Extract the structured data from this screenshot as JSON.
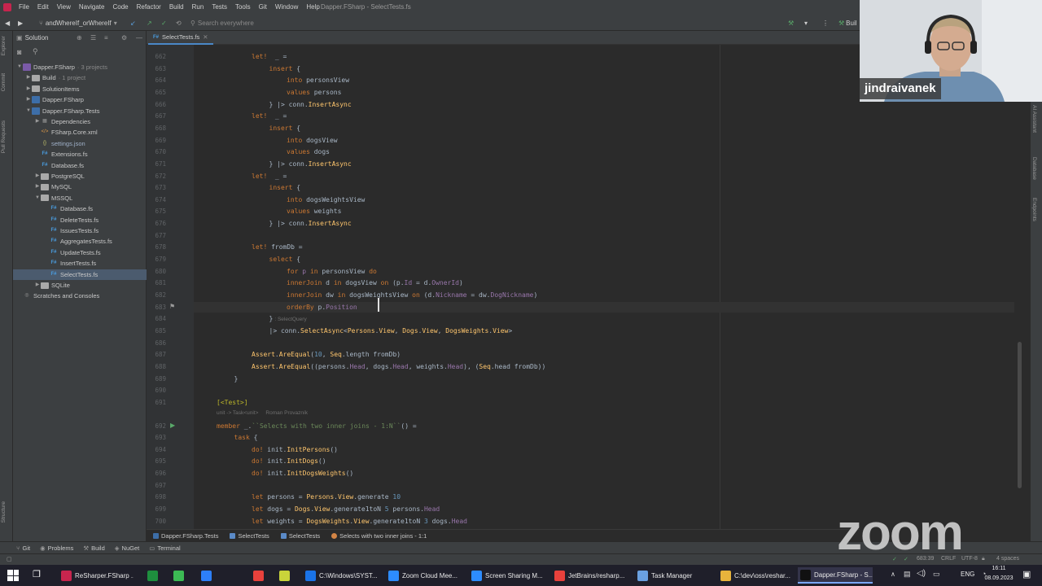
{
  "window": {
    "title": "Dapper.FSharp - SelectTests.fs"
  },
  "menu": [
    "File",
    "Edit",
    "View",
    "Navigate",
    "Code",
    "Refactor",
    "Build",
    "Run",
    "Tests",
    "Tools",
    "Git",
    "Window",
    "Help"
  ],
  "toolbar": {
    "branch": "andWhereIf_orWhereIf",
    "search_placeholder": "Search everywhere",
    "build_label": "Buil"
  },
  "left_strip": [
    "Explorer",
    "Commit",
    "Pull Requests",
    "Structure"
  ],
  "project": {
    "header": "Solution",
    "tree": [
      {
        "label": "Dapper.FSharp",
        "note": "· 3 projects",
        "icon": "solution-icon",
        "depth": 0,
        "expanded": true
      },
      {
        "label": "Build",
        "note": "· 1 project",
        "icon": "folder-icon",
        "depth": 1,
        "expanded": false
      },
      {
        "label": "SolutionItems",
        "note": "",
        "icon": "folder-icon",
        "depth": 1,
        "expanded": false
      },
      {
        "label": "Dapper.FSharp",
        "note": "",
        "icon": "project-icon",
        "depth": 1,
        "expanded": false
      },
      {
        "label": "Dapper.FSharp.Tests",
        "note": "",
        "icon": "project-icon",
        "depth": 1,
        "expanded": true
      },
      {
        "label": "Dependencies",
        "note": "",
        "icon": "dependencies-icon",
        "depth": 2,
        "expanded": false
      },
      {
        "label": "FSharp.Core.xml",
        "note": "",
        "icon": "xml-file-icon",
        "depth": 2
      },
      {
        "label": "settings.json",
        "note": "",
        "icon": "json-file-icon",
        "depth": 2
      },
      {
        "label": "Extensions.fs",
        "note": "",
        "icon": "fs-file-icon",
        "depth": 2
      },
      {
        "label": "Database.fs",
        "note": "",
        "icon": "fs-file-icon",
        "depth": 2
      },
      {
        "label": "PostgreSQL",
        "note": "",
        "icon": "folder-icon",
        "depth": 2,
        "expanded": false
      },
      {
        "label": "MySQL",
        "note": "",
        "icon": "folder-icon",
        "depth": 2,
        "expanded": false
      },
      {
        "label": "MSSQL",
        "note": "",
        "icon": "folder-icon",
        "depth": 2,
        "expanded": true
      },
      {
        "label": "Database.fs",
        "note": "",
        "icon": "fs-file-icon",
        "depth": 3
      },
      {
        "label": "DeleteTests.fs",
        "note": "",
        "icon": "fs-file-icon",
        "depth": 3
      },
      {
        "label": "IssuesTests.fs",
        "note": "",
        "icon": "fs-file-icon",
        "depth": 3
      },
      {
        "label": "AggregatesTests.fs",
        "note": "",
        "icon": "fs-file-icon",
        "depth": 3
      },
      {
        "label": "UpdateTests.fs",
        "note": "",
        "icon": "fs-file-icon",
        "depth": 3
      },
      {
        "label": "InsertTests.fs",
        "note": "",
        "icon": "fs-file-icon",
        "depth": 3
      },
      {
        "label": "SelectTests.fs",
        "note": "",
        "icon": "fs-file-icon",
        "depth": 3,
        "selected": true
      },
      {
        "label": "SQLite",
        "note": "",
        "icon": "folder-icon",
        "depth": 2,
        "expanded": false
      },
      {
        "label": "Scratches and Consoles",
        "note": "",
        "icon": "scratches-icon",
        "depth": 0
      }
    ]
  },
  "editor": {
    "tab": "SelectTests.fs",
    "lines": [
      {
        "n": "662",
        "indent": 2,
        "t": [
          [
            "kw",
            "let!"
          ],
          [
            "",
            "  _ ="
          ]
        ]
      },
      {
        "n": "663",
        "indent": 3,
        "t": [
          [
            "kw",
            "insert"
          ],
          [
            "",
            " {"
          ]
        ]
      },
      {
        "n": "664",
        "indent": 4,
        "t": [
          [
            "kw",
            "into"
          ],
          [
            "",
            " personsView"
          ]
        ]
      },
      {
        "n": "665",
        "indent": 4,
        "t": [
          [
            "kw",
            "values"
          ],
          [
            "",
            " persons"
          ]
        ]
      },
      {
        "n": "666",
        "indent": 3,
        "t": [
          [
            "",
            "} |> conn."
          ],
          [
            "fn",
            "InsertAsync"
          ]
        ]
      },
      {
        "n": "667",
        "indent": 2,
        "t": [
          [
            "kw",
            "let!"
          ],
          [
            "",
            "  _ ="
          ]
        ]
      },
      {
        "n": "668",
        "indent": 3,
        "t": [
          [
            "kw",
            "insert"
          ],
          [
            "",
            " {"
          ]
        ]
      },
      {
        "n": "669",
        "indent": 4,
        "t": [
          [
            "kw",
            "into"
          ],
          [
            "",
            " dogsView"
          ]
        ]
      },
      {
        "n": "670",
        "indent": 4,
        "t": [
          [
            "kw",
            "values"
          ],
          [
            "",
            " dogs"
          ]
        ]
      },
      {
        "n": "671",
        "indent": 3,
        "t": [
          [
            "",
            "} |> conn."
          ],
          [
            "fn",
            "InsertAsync"
          ]
        ]
      },
      {
        "n": "672",
        "indent": 2,
        "t": [
          [
            "kw",
            "let!"
          ],
          [
            "",
            "  _ ="
          ]
        ]
      },
      {
        "n": "673",
        "indent": 3,
        "t": [
          [
            "kw",
            "insert"
          ],
          [
            "",
            " {"
          ]
        ]
      },
      {
        "n": "674",
        "indent": 4,
        "t": [
          [
            "kw",
            "into"
          ],
          [
            "",
            " dogsWeightsView"
          ]
        ]
      },
      {
        "n": "675",
        "indent": 4,
        "t": [
          [
            "kw",
            "values"
          ],
          [
            "",
            " weights"
          ]
        ]
      },
      {
        "n": "676",
        "indent": 3,
        "t": [
          [
            "",
            "} |> conn."
          ],
          [
            "fn",
            "InsertAsync"
          ]
        ]
      },
      {
        "n": "677",
        "indent": 0,
        "t": []
      },
      {
        "n": "678",
        "indent": 2,
        "t": [
          [
            "kw",
            "let!"
          ],
          [
            "",
            " fromDb ="
          ]
        ]
      },
      {
        "n": "679",
        "indent": 3,
        "t": [
          [
            "kw",
            "select"
          ],
          [
            "",
            " {"
          ]
        ]
      },
      {
        "n": "680",
        "indent": 4,
        "t": [
          [
            "kw",
            "for"
          ],
          [
            "",
            " "
          ],
          [
            "vl",
            "p"
          ],
          [
            "",
            " "
          ],
          [
            "kw",
            "in"
          ],
          [
            "",
            " personsView "
          ],
          [
            "kw",
            "do"
          ]
        ]
      },
      {
        "n": "681",
        "indent": 4,
        "t": [
          [
            "kw",
            "innerJoin"
          ],
          [
            "",
            " d "
          ],
          [
            "kw",
            "in"
          ],
          [
            "",
            " dogsView "
          ],
          [
            "kw",
            "on"
          ],
          [
            "",
            " (p."
          ],
          [
            "vl",
            "Id"
          ],
          [
            "",
            " = d."
          ],
          [
            "vl",
            "OwnerId"
          ],
          [
            "",
            ")"
          ]
        ]
      },
      {
        "n": "682",
        "indent": 4,
        "t": [
          [
            "kw",
            "innerJoin"
          ],
          [
            "",
            " dw "
          ],
          [
            "kw",
            "in"
          ],
          [
            "",
            " dogsWeightsView "
          ],
          [
            "kw",
            "on"
          ],
          [
            "",
            " (d."
          ],
          [
            "vl",
            "Nickname"
          ],
          [
            "",
            " = dw."
          ],
          [
            "vl",
            "DogNickname"
          ],
          [
            "",
            ")"
          ]
        ]
      },
      {
        "n": "683",
        "indent": 4,
        "t": [
          [
            "kw",
            "orderBy"
          ],
          [
            "",
            " p."
          ],
          [
            "vl",
            "Position"
          ]
        ],
        "current": true
      },
      {
        "n": "684",
        "indent": 3,
        "t": [
          [
            "",
            "}"
          ]
        ],
        "hint": ": SelectQuery"
      },
      {
        "n": "685",
        "indent": 3,
        "t": [
          [
            "",
            "|> conn."
          ],
          [
            "fn",
            "SelectAsync"
          ],
          [
            "",
            "<"
          ],
          [
            "ty",
            "Persons"
          ],
          [
            "",
            "."
          ],
          [
            "ty",
            "View"
          ],
          [
            "",
            ", "
          ],
          [
            "ty",
            "Dogs"
          ],
          [
            "",
            "."
          ],
          [
            "ty",
            "View"
          ],
          [
            "",
            ", "
          ],
          [
            "ty",
            "DogsWeights"
          ],
          [
            "",
            "."
          ],
          [
            "ty",
            "View"
          ],
          [
            "",
            ">"
          ]
        ]
      },
      {
        "n": "686",
        "indent": 0,
        "t": []
      },
      {
        "n": "687",
        "indent": 2,
        "t": [
          [
            "ty",
            "Assert"
          ],
          [
            "",
            "."
          ],
          [
            "fn",
            "AreEqual"
          ],
          [
            "",
            "("
          ],
          [
            "nm",
            "10"
          ],
          [
            "",
            ", "
          ],
          [
            "ty",
            "Seq"
          ],
          [
            "",
            ".length fromDb)"
          ]
        ]
      },
      {
        "n": "688",
        "indent": 2,
        "t": [
          [
            "ty",
            "Assert"
          ],
          [
            "",
            "."
          ],
          [
            "fn",
            "AreEqual"
          ],
          [
            "",
            "((persons."
          ],
          [
            "vl",
            "Head"
          ],
          [
            "",
            ", dogs."
          ],
          [
            "vl",
            "Head"
          ],
          [
            "",
            ", weights."
          ],
          [
            "vl",
            "Head"
          ],
          [
            "",
            "), ("
          ],
          [
            "ty",
            "Seq"
          ],
          [
            "",
            ".head fromDb))"
          ]
        ]
      },
      {
        "n": "689",
        "indent": 1,
        "t": [
          [
            "",
            "}"
          ]
        ]
      },
      {
        "n": "690",
        "indent": 0,
        "t": []
      },
      {
        "n": "691",
        "indent": 0,
        "t": [
          [
            "at",
            "[<Test>]"
          ]
        ],
        "hint_below": "unit -> Task<unit>     Roman Provazník"
      },
      {
        "n": "692",
        "indent": 0,
        "t": [
          [
            "kw",
            "member"
          ],
          [
            "",
            " _."
          ],
          [
            "st",
            "``Selects with two inner joins - 1:N``"
          ],
          [
            "",
            "() ="
          ]
        ],
        "runnable": true
      },
      {
        "n": "693",
        "indent": 1,
        "t": [
          [
            "kw",
            "task"
          ],
          [
            "",
            " {"
          ]
        ]
      },
      {
        "n": "694",
        "indent": 2,
        "t": [
          [
            "kw",
            "do!"
          ],
          [
            "",
            " init."
          ],
          [
            "fn",
            "InitPersons"
          ],
          [
            "",
            "()"
          ]
        ]
      },
      {
        "n": "695",
        "indent": 2,
        "t": [
          [
            "kw",
            "do!"
          ],
          [
            "",
            " init."
          ],
          [
            "fn",
            "InitDogs"
          ],
          [
            "",
            "()"
          ]
        ]
      },
      {
        "n": "696",
        "indent": 2,
        "t": [
          [
            "kw",
            "do!"
          ],
          [
            "",
            " init."
          ],
          [
            "fn",
            "InitDogsWeights"
          ],
          [
            "",
            "()"
          ]
        ]
      },
      {
        "n": "697",
        "indent": 0,
        "t": []
      },
      {
        "n": "698",
        "indent": 2,
        "t": [
          [
            "kw",
            "let"
          ],
          [
            "",
            " persons = "
          ],
          [
            "ty",
            "Persons"
          ],
          [
            "",
            "."
          ],
          [
            "ty",
            "View"
          ],
          [
            "",
            ".generate "
          ],
          [
            "nm",
            "10"
          ]
        ]
      },
      {
        "n": "699",
        "indent": 2,
        "t": [
          [
            "kw",
            "let"
          ],
          [
            "",
            " dogs = "
          ],
          [
            "ty",
            "Dogs"
          ],
          [
            "",
            "."
          ],
          [
            "ty",
            "View"
          ],
          [
            "",
            ".generate1toN "
          ],
          [
            "nm",
            "5"
          ],
          [
            "",
            " persons."
          ],
          [
            "vl",
            "Head"
          ]
        ]
      },
      {
        "n": "700",
        "indent": 2,
        "t": [
          [
            "kw",
            "let"
          ],
          [
            "",
            " weights = "
          ],
          [
            "ty",
            "DogsWeights"
          ],
          [
            "",
            "."
          ],
          [
            "ty",
            "View"
          ],
          [
            "",
            ".generate1toN "
          ],
          [
            "nm",
            "3"
          ],
          [
            "",
            " dogs."
          ],
          [
            "vl",
            "Head"
          ]
        ]
      }
    ]
  },
  "breadcrumb": [
    "Dapper.FSharp.Tests",
    "SelectTests",
    "SelectTests",
    "Selects with two inner joins - 1:1"
  ],
  "right_strip": [
    "AI Assistant",
    "Database",
    "Endpoints"
  ],
  "bottom_tools": [
    "Git",
    "Problems",
    "Build",
    "NuGet",
    "Terminal"
  ],
  "status": {
    "position": "683:39",
    "line_ending": "CRLF",
    "encoding": "UTF-8",
    "indent": "4 spaces"
  },
  "taskbar": {
    "items": [
      {
        "label": "ReSharper.FSharp ...",
        "color": "#c7254e"
      },
      {
        "label": "",
        "color": "#1e8e3e"
      },
      {
        "label": "",
        "color": "#3cba54"
      },
      {
        "label": "",
        "color": "#2d7ff9"
      },
      {
        "label": "",
        "color": "#e8413c"
      },
      {
        "label": "",
        "color": "#c9d43a"
      },
      {
        "label": "C:\\Windows\\SYST...",
        "color": "#1a73e8"
      },
      {
        "label": "Zoom Cloud Mee...",
        "color": "#2d8cff"
      },
      {
        "label": "Screen Sharing M...",
        "color": "#2d8cff"
      },
      {
        "label": "JetBrains/resharp...",
        "color": "#e8413c"
      },
      {
        "label": "Task Manager",
        "color": "#6aa0e0"
      },
      {
        "label": "C:\\dev\\oss\\reshar...",
        "color": "#e8b43c"
      },
      {
        "label": "Dapper.FSharp - S...",
        "color": "#111111",
        "active": true
      }
    ],
    "lang": "ENG",
    "time": "16:11",
    "date": "08.09.2023"
  },
  "webcam": {
    "participant": "jindraivanek"
  },
  "overlay": {
    "logo": "zoom"
  },
  "colors": {
    "keyword": "#cc7832",
    "function": "#ffc66d",
    "number": "#6897bb",
    "property": "#9876aa",
    "string": "#6a8759",
    "selection": "#4b5b6e"
  }
}
